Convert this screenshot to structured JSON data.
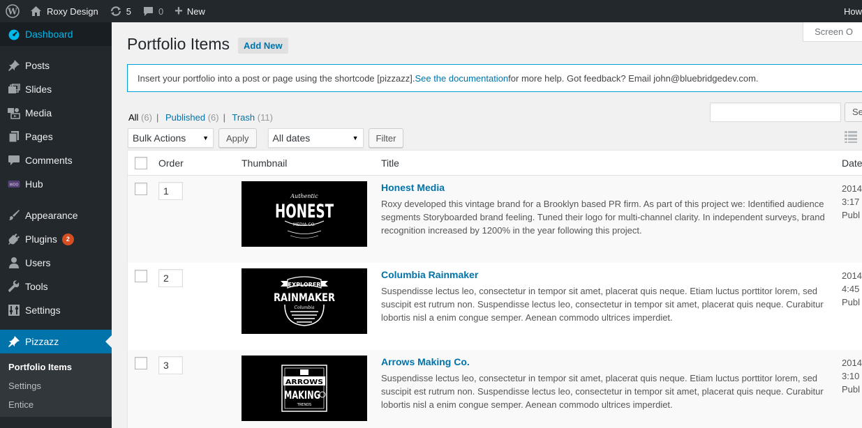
{
  "adminbar": {
    "site_name": "Roxy Design",
    "updates_count": "5",
    "comments_count": "0",
    "new_label": "New",
    "howdy": "How"
  },
  "sidebar": {
    "items": [
      {
        "label": "Dashboard",
        "icon": "dashboard-icon"
      },
      {
        "label": "Posts",
        "icon": "pin-icon"
      },
      {
        "label": "Slides",
        "icon": "slides-icon"
      },
      {
        "label": "Media",
        "icon": "media-icon"
      },
      {
        "label": "Pages",
        "icon": "pages-icon"
      },
      {
        "label": "Comments",
        "icon": "comment-icon"
      },
      {
        "label": "Hub",
        "icon": "woo-icon"
      },
      {
        "label": "Appearance",
        "icon": "brush-icon"
      },
      {
        "label": "Plugins",
        "icon": "plugin-icon",
        "badge": "2"
      },
      {
        "label": "Users",
        "icon": "user-icon"
      },
      {
        "label": "Tools",
        "icon": "wrench-icon"
      },
      {
        "label": "Settings",
        "icon": "settings-icon"
      },
      {
        "label": "Pizzazz",
        "icon": "pin-icon"
      }
    ],
    "submenu": [
      "Portfolio Items",
      "Settings",
      "Entice"
    ]
  },
  "screen_options": "Screen O",
  "page": {
    "title": "Portfolio Items",
    "add_new": "Add New"
  },
  "notice": {
    "before": "Insert your portfolio into a post or page using the shortcode [pizzazz]. ",
    "link": "See the documentation",
    "after": " for more help. Got feedback? Email john@bluebridgedev.com."
  },
  "filters": {
    "all": "All",
    "all_count": "(6)",
    "published": "Published",
    "published_count": "(6)",
    "trash": "Trash",
    "trash_count": "(11)"
  },
  "search_button": "Se",
  "tablenav": {
    "bulk_actions": "Bulk Actions",
    "apply": "Apply",
    "dates": "All dates",
    "filter": "Filter"
  },
  "columns": {
    "order": "Order",
    "thumbnail": "Thumbnail",
    "title": "Title",
    "date": "Date"
  },
  "rows": [
    {
      "order": "1",
      "title": "Honest Media",
      "description": "Roxy developed this vintage brand for a Brooklyn based PR firm.  As part of this project we: Identified audience segments Storyboarded brand feeling. Tuned their logo for multi-channel clarity. In independent surveys, brand recognition increased by 1200% in the year following this project.",
      "date_line1": "2014",
      "date_line2": "3:17",
      "date_line3": "Publ",
      "logo_main": "HONEST",
      "logo_top": "Authentic",
      "logo_sub": "MEDIA CO."
    },
    {
      "order": "2",
      "title": "Columbia Rainmaker",
      "description": "Suspendisse lectus leo, consectetur in tempor sit amet, placerat quis neque. Etiam luctus porttitor lorem, sed suscipit est rutrum non.  Suspendisse lectus leo, consectetur in tempor sit amet, placerat quis neque.   Curabitur lobortis nisl a enim congue semper. Aenean commodo ultrices imperdiet.",
      "date_line1": "2014",
      "date_line2": "4:45",
      "date_line3": "Publ",
      "logo_top": "EXPLORER",
      "logo_main": "RAINMAKER",
      "logo_sub": "Columbia"
    },
    {
      "order": "3",
      "title": "Arrows Making Co.",
      "description": "Suspendisse lectus leo, consectetur in tempor sit amet, placerat quis neque. Etiam luctus porttitor lorem, sed suscipit est rutrum non.  Suspendisse lectus leo, consectetur in tempor sit amet, placerat quis neque.   Curabitur lobortis nisl a enim congue semper. Aenean commodo ultrices imperdiet.",
      "date_line1": "2014",
      "date_line2": "3:10",
      "date_line3": "Publ",
      "logo_top": "ARROWS",
      "logo_main": "MAKING",
      "logo_sub": "TRENDS"
    }
  ]
}
